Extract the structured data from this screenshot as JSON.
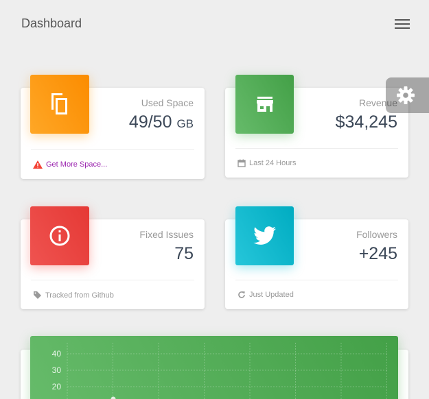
{
  "navbar": {
    "brand": "Dashboard",
    "menu_icon": "hamburger-icon"
  },
  "settings": {
    "icon": "gear-icon"
  },
  "stats": [
    {
      "icon": "copy-icon",
      "color": "#fb8c00",
      "category": "Used Space",
      "value": "49/50",
      "unit": "GB",
      "footer_icon": "warning-icon",
      "footer_icon_color": "#f44336",
      "footer_text": "Get More Space..."
    },
    {
      "icon": "store-icon",
      "color": "#43a047",
      "category": "Revenue",
      "value": "$34,245",
      "footer_icon": "calendar-icon",
      "footer_text": "Last 24 Hours"
    },
    {
      "icon": "info-icon",
      "color": "#e53935",
      "category": "Fixed Issues",
      "value": "75",
      "footer_icon": "tag-icon",
      "footer_text": "Tracked from Github"
    },
    {
      "icon": "twitter-icon",
      "color": "#00acc1",
      "category": "Followers",
      "value": "+245",
      "footer_icon": "refresh-icon",
      "footer_text": "Just Updated"
    }
  ],
  "chart_data": {
    "type": "line",
    "y_ticks": [
      "40",
      "30",
      "20"
    ],
    "grid": true
  }
}
